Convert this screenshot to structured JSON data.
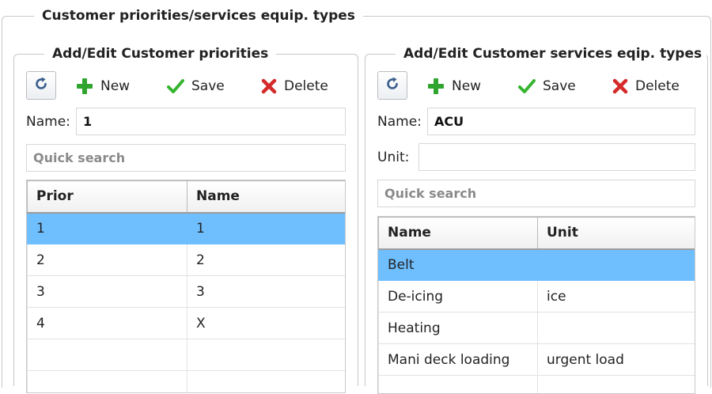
{
  "outer": {
    "title": "Customer priorities/services equip. types"
  },
  "priorities_panel": {
    "title": "Add/Edit Customer priorities",
    "toolbar": {
      "new_label": "New",
      "save_label": "Save",
      "delete_label": "Delete"
    },
    "name_label": "Name:",
    "name_value": "1",
    "search_placeholder": "Quick search",
    "columns": [
      "Prior",
      "Name"
    ],
    "rows": [
      [
        "1",
        "1"
      ],
      [
        "2",
        "2"
      ],
      [
        "3",
        "3"
      ],
      [
        "4",
        "X"
      ],
      [
        "",
        ""
      ],
      [
        "",
        ""
      ]
    ],
    "selected_row": 0
  },
  "services_panel": {
    "title": "Add/Edit Customer services eqip. types",
    "toolbar": {
      "new_label": "New",
      "save_label": "Save",
      "delete_label": "Delete"
    },
    "name_label": "Name:",
    "name_value": "ACU",
    "unit_label": "Unit:",
    "unit_value": "",
    "search_placeholder": "Quick search",
    "columns": [
      "Name",
      "Unit"
    ],
    "rows": [
      [
        "Belt",
        ""
      ],
      [
        "De-icing",
        "ice"
      ],
      [
        "Heating",
        ""
      ],
      [
        "Mani deck loading",
        "urgent load"
      ],
      [
        "",
        ""
      ]
    ],
    "selected_row": 0
  },
  "colors": {
    "selection": "#6fbfff",
    "new_icon": "#2fa52f",
    "save_icon": "#35b52f",
    "delete_icon": "#d42a2a",
    "refresh_icon": "#3a5e8c"
  },
  "icons": {
    "refresh": "refresh-icon",
    "new": "plus-icon",
    "save": "checkmark-icon",
    "delete": "x-icon"
  }
}
